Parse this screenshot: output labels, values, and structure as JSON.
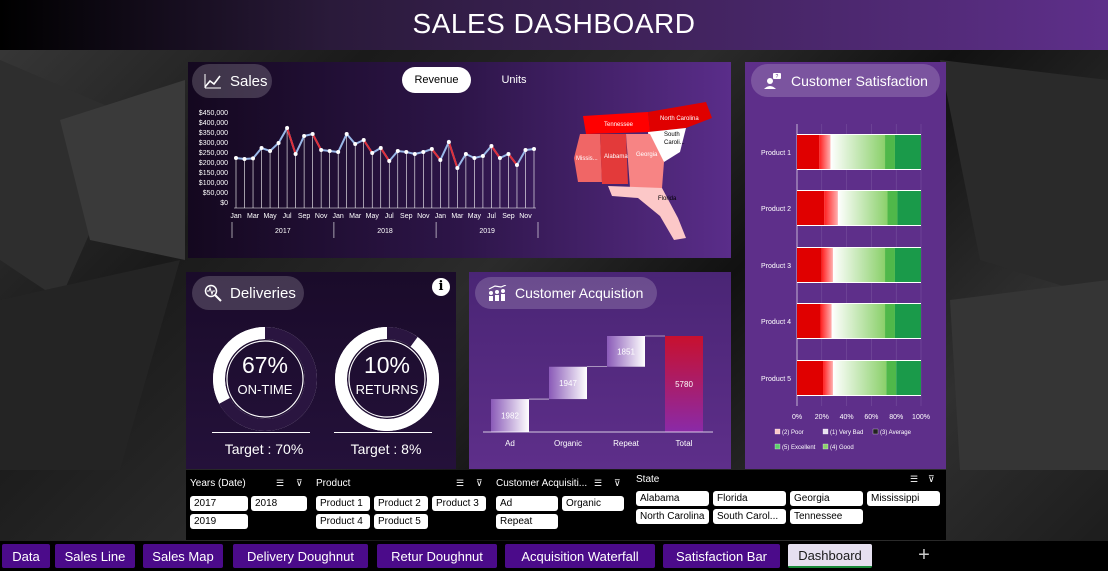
{
  "title": "SALES DASHBOARD",
  "sales": {
    "label": "Sales",
    "toggle": {
      "revenue": "Revenue",
      "units": "Units"
    },
    "y_ticks": [
      "$450,000",
      "$400,000",
      "$350,000",
      "$300,000",
      "$250,000",
      "$200,000",
      "$150,000",
      "$100,000",
      "$50,000",
      "$0"
    ],
    "month_ticks": [
      "Jan",
      "Mar",
      "May",
      "Jul",
      "Sep",
      "Nov",
      "Jan",
      "Mar",
      "May",
      "Jul",
      "Sep",
      "Nov",
      "Jan",
      "Mar",
      "May",
      "Jul",
      "Sep",
      "Nov"
    ],
    "years": [
      "2017",
      "2018",
      "2019"
    ],
    "map_labels": [
      "Tennessee",
      "North Carolina",
      "South Caroli...",
      "Missis...",
      "Alabama",
      "Georgia",
      "Florida"
    ]
  },
  "chart_data": [
    {
      "type": "line",
      "x": [
        "Jan 2017",
        "Feb 2017",
        "Mar 2017",
        "Apr 2017",
        "May 2017",
        "Jun 2017",
        "Jul 2017",
        "Aug 2017",
        "Sep 2017",
        "Oct 2017",
        "Nov 2017",
        "Dec 2017",
        "Jan 2018",
        "Feb 2018",
        "Mar 2018",
        "Apr 2018",
        "May 2018",
        "Jun 2018",
        "Jul 2018",
        "Aug 2018",
        "Sep 2018",
        "Oct 2018",
        "Nov 2018",
        "Dec 2018",
        "Jan 2019",
        "Feb 2019",
        "Mar 2019",
        "Apr 2019",
        "May 2019",
        "Jun 2019",
        "Jul 2019",
        "Aug 2019",
        "Sep 2019",
        "Oct 2019",
        "Nov 2019",
        "Dec 2019"
      ],
      "series": [
        {
          "values": [
            230000,
            225000,
            228000,
            280000,
            265000,
            305000,
            380000,
            250000,
            340000,
            350000,
            270000,
            265000,
            260000,
            350000,
            300000,
            320000,
            255000,
            280000,
            215000,
            265000,
            260000,
            250000,
            260000,
            275000,
            220000,
            310000,
            180000,
            250000,
            230000,
            240000,
            290000,
            230000,
            250000,
            195000,
            270000,
            275000
          ]
        }
      ],
      "ylim": [
        0,
        450000
      ]
    },
    {
      "type": "pie",
      "name": "On-time deliveries",
      "value": 67,
      "center_pct": "67%",
      "center_label": "ON-TIME",
      "target": "Target : 70%"
    },
    {
      "type": "pie",
      "name": "Returns",
      "value": 10,
      "center_pct": "10%",
      "center_label": "RETURNS",
      "target": "Target : 8%"
    },
    {
      "type": "bar",
      "subtype": "waterfall",
      "categories": [
        "Ad",
        "Organic",
        "Repeat",
        "Total"
      ],
      "values": [
        1982,
        1947,
        1851,
        5780
      ]
    },
    {
      "type": "bar",
      "subtype": "100% stacked",
      "categories": [
        "Product 1",
        "Product 2",
        "Product 3",
        "Product 4",
        "Product 5"
      ],
      "x_ticks": [
        "0%",
        "20%",
        "40%",
        "60%",
        "80%",
        "100%"
      ],
      "legend": [
        "(2) Poor",
        "(1) Very Bad",
        "(3) Average",
        "(5) Excellent",
        "(4) Good"
      ],
      "series": [
        {
          "name": "(1) Very Bad",
          "values": [
            18,
            22,
            20,
            19,
            21
          ]
        },
        {
          "name": "(2) Poor",
          "values": [
            9,
            11,
            9,
            9,
            8
          ]
        },
        {
          "name": "(3) Average",
          "values": [
            44,
            40,
            42,
            43,
            43
          ]
        },
        {
          "name": "(4) Good",
          "values": [
            8,
            8,
            8,
            8,
            8
          ]
        },
        {
          "name": "(5) Excellent",
          "values": [
            21,
            19,
            21,
            21,
            20
          ]
        }
      ]
    }
  ],
  "deliveries": {
    "label": "Deliveries",
    "info_icon": "info-icon"
  },
  "acquisition": {
    "label": "Customer Acquistion"
  },
  "satisfaction": {
    "label": "Customer Satisfaction"
  },
  "slicers": {
    "years": {
      "title": "Years (Date)",
      "items": [
        "2017",
        "2018",
        "2019"
      ]
    },
    "product": {
      "title": "Product",
      "items": [
        "Product 1",
        "Product 2",
        "Product 3",
        "Product 4",
        "Product 5"
      ]
    },
    "acq": {
      "title": "Customer Acquisiti...",
      "items": [
        "Ad",
        "Organic",
        "Repeat"
      ]
    },
    "state": {
      "title": "State",
      "items": [
        "Alabama",
        "Florida",
        "Georgia",
        "Mississippi",
        "North Carolina",
        "South Carol...",
        "Tennessee"
      ]
    }
  },
  "tabs": [
    "Data",
    "Sales Line",
    "Sales Map",
    "Delivery Doughnut",
    "Retur Doughnut",
    "Acquisition Waterfall",
    "Satisfaction Bar",
    "Dashboard"
  ],
  "add_tab": "+",
  "colors": {
    "purple": "#5e2f8a",
    "tab": "#4b0b8a",
    "red": "#e00000",
    "green": "#1a9a4a"
  }
}
